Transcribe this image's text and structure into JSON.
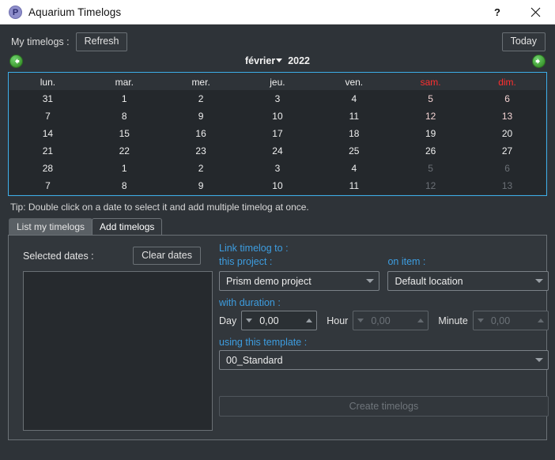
{
  "window": {
    "title": "Aquarium Timelogs",
    "icon": "prism-logo-icon",
    "icon_letter": "P",
    "help_label": "?",
    "close_label": "✕"
  },
  "toolbar": {
    "my_timelogs_label": "My timelogs :",
    "refresh_label": "Refresh",
    "today_label": "Today"
  },
  "calendar": {
    "prev_label": "←",
    "next_label": "→",
    "month": "février",
    "year": "2022",
    "weekdays": [
      "lun.",
      "mar.",
      "mer.",
      "jeu.",
      "ven.",
      "sam.",
      "dim."
    ],
    "weekend_columns": [
      5,
      6
    ],
    "accent_border": "#3daee9",
    "colors": {
      "red": "#a85055",
      "green": "#4ccb5e",
      "selected_blue": "#3aa9e5",
      "out_of_month": "#6b7076",
      "weekend_text": "#ff2f2f"
    },
    "weeks": [
      [
        {
          "day": "31",
          "state": "out-dark"
        },
        {
          "day": "1",
          "state": "red"
        },
        {
          "day": "2",
          "state": "red"
        },
        {
          "day": "3",
          "state": "red"
        },
        {
          "day": "4",
          "state": "red"
        },
        {
          "day": "5",
          "state": "red"
        },
        {
          "day": "6",
          "state": "red"
        }
      ],
      [
        {
          "day": "7",
          "state": "red"
        },
        {
          "day": "8",
          "state": "green"
        },
        {
          "day": "9",
          "state": "red"
        },
        {
          "day": "10",
          "state": "red"
        },
        {
          "day": "11",
          "state": "red"
        },
        {
          "day": "12",
          "state": "red"
        },
        {
          "day": "13",
          "state": "red"
        }
      ],
      [
        {
          "day": "14",
          "state": "red"
        },
        {
          "day": "15",
          "state": "green"
        },
        {
          "day": "16",
          "state": "normal"
        },
        {
          "day": "17",
          "state": "normal"
        },
        {
          "day": "18",
          "state": "normal"
        },
        {
          "day": "19",
          "state": "normal"
        },
        {
          "day": "20",
          "state": "normal"
        }
      ],
      [
        {
          "day": "21",
          "state": "normal"
        },
        {
          "day": "22",
          "state": "normal"
        },
        {
          "day": "23",
          "state": "normal"
        },
        {
          "day": "24",
          "state": "sel"
        },
        {
          "day": "25",
          "state": "normal"
        },
        {
          "day": "26",
          "state": "normal"
        },
        {
          "day": "27",
          "state": "normal"
        }
      ],
      [
        {
          "day": "28",
          "state": "normal"
        },
        {
          "day": "1",
          "state": "out"
        },
        {
          "day": "2",
          "state": "out"
        },
        {
          "day": "3",
          "state": "out"
        },
        {
          "day": "4",
          "state": "out"
        },
        {
          "day": "5",
          "state": "out"
        },
        {
          "day": "6",
          "state": "out"
        }
      ],
      [
        {
          "day": "7",
          "state": "out"
        },
        {
          "day": "8",
          "state": "out"
        },
        {
          "day": "9",
          "state": "out"
        },
        {
          "day": "10",
          "state": "out"
        },
        {
          "day": "11",
          "state": "out"
        },
        {
          "day": "12",
          "state": "out"
        },
        {
          "day": "13",
          "state": "out"
        }
      ]
    ]
  },
  "tip": "Tip: Double click on a date to select it and add multiple timelog at once.",
  "tabs": [
    {
      "label": "List my timelogs",
      "active": false
    },
    {
      "label": "Add timelogs",
      "active": true
    }
  ],
  "form": {
    "selected_dates_label": "Selected dates :",
    "clear_dates_label": "Clear dates",
    "selected_dates_items": [],
    "link_timelog_label": "Link timelog to :",
    "this_project_label": "this project :",
    "project_value": "Prism demo project",
    "on_item_label": "on item :",
    "item_value": "Default location",
    "with_duration_label": "with duration :",
    "day_label": "Day",
    "day_value": "0,00",
    "hour_label": "Hour",
    "hour_value": "0,00",
    "minute_label": "Minute",
    "minute_value": "0,00",
    "using_template_label": "using this template :",
    "template_value": "00_Standard",
    "create_label": "Create timelogs"
  }
}
